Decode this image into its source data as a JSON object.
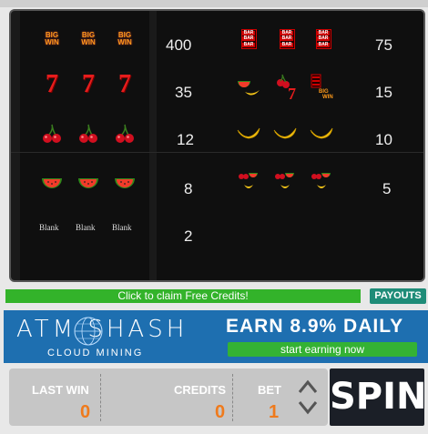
{
  "paytable": {
    "left": [
      {
        "symbol": "big-win",
        "label": "BIG WIN",
        "payout": "400"
      },
      {
        "symbol": "seven",
        "label": "7",
        "payout": "35"
      },
      {
        "symbol": "cherry",
        "label": "",
        "payout": "12"
      },
      {
        "symbol": "watermelon",
        "label": "",
        "payout": "8"
      },
      {
        "symbol": "blank",
        "label": "Blank",
        "payout": "2"
      }
    ],
    "right": [
      {
        "symbol": "bar",
        "label": "BAR",
        "payout": "75"
      },
      {
        "symbol": "mixed",
        "label": "",
        "payout": "15"
      },
      {
        "symbol": "banana",
        "label": "",
        "payout": "10"
      },
      {
        "symbol": "fruit-mix",
        "label": "",
        "payout": "5"
      }
    ]
  },
  "claim_label": "Click to claim Free Credits!",
  "payouts_label": "PAYOUTS",
  "ad": {
    "logo": "ATM SHASH",
    "sub": "CLOUD MINING",
    "earn": "EARN 8.9% DAILY",
    "cta": "start earning now"
  },
  "controls": {
    "last_win_label": "LAST WIN",
    "last_win": "0",
    "credits_label": "CREDITS",
    "credits": "0",
    "bet_label": "BET",
    "bet": "1",
    "spin_label": "SPIN"
  },
  "colors": {
    "accent": "#ef7a1c",
    "claim_bg": "#33b32a",
    "ad_bg": "#1e6fb0"
  }
}
